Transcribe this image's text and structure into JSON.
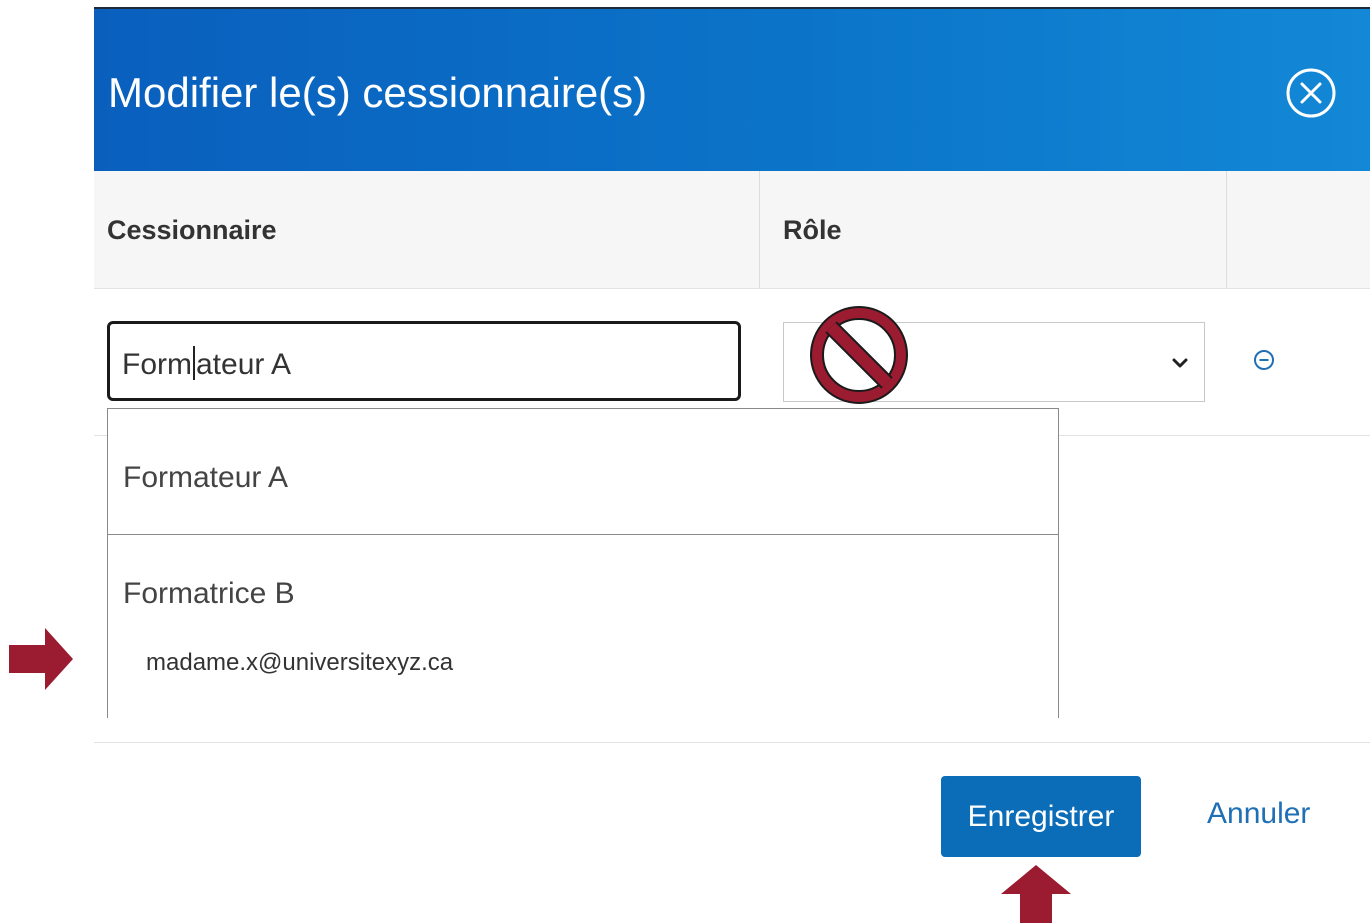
{
  "dialog": {
    "title": "Modifier le(s) cessionnaire(s)",
    "close_icon": "close-circle-icon"
  },
  "columns": {
    "assignee": "Cessionnaire",
    "role": "Rôle"
  },
  "row": {
    "assignee_input": {
      "value_typed": "Form",
      "value_rest": "ateur  A"
    },
    "role_select": {
      "value": "",
      "icon": "chevron-down-icon"
    },
    "remove_icon": "minus-circle-icon"
  },
  "suggestions": [
    {
      "name": "Formateur A"
    },
    {
      "name": "Formatrice B",
      "email": "madame.x@universitexyz.ca"
    }
  ],
  "footer": {
    "save_label": "Enregistrer",
    "cancel_label": "Annuler"
  },
  "annotations": {
    "forbidden_icon": "no-entry-icon",
    "arrow_right_icon": "arrow-right-icon",
    "arrow_up_icon": "arrow-up-icon",
    "color": "#9b1b30"
  },
  "colors": {
    "header_start": "#0a5fbd",
    "header_end": "#1388d6",
    "primary_button": "#0b6cb8",
    "link": "#1f6fb5"
  }
}
